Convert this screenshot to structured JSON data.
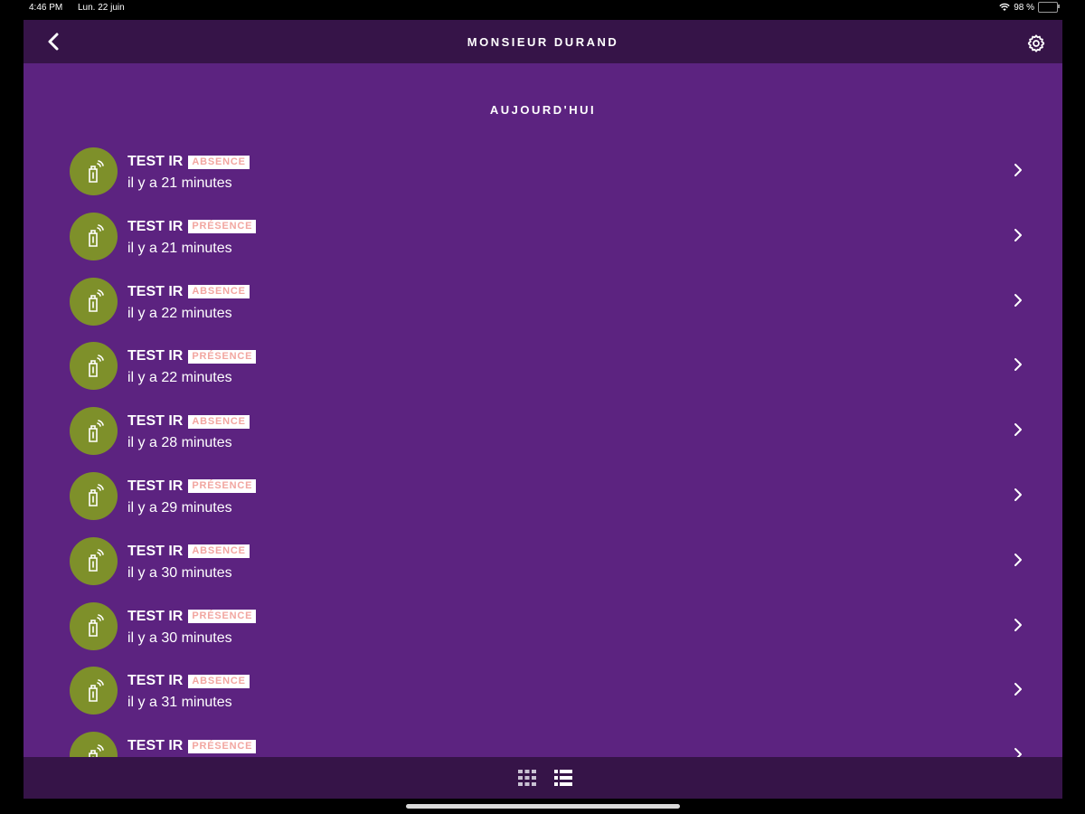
{
  "status_bar": {
    "time": "4:46 PM",
    "date": "Lun. 22 juin",
    "battery": "98 %"
  },
  "header": {
    "title": "MONSIEUR DURAND"
  },
  "section": {
    "title": "AUJOURD'HUI"
  },
  "events": [
    {
      "name": "TEST IR",
      "status": "ABSENCE",
      "time": "il y a 21 minutes"
    },
    {
      "name": "TEST IR",
      "status": "PRÉSENCE",
      "time": "il y a 21 minutes"
    },
    {
      "name": "TEST IR",
      "status": "ABSENCE",
      "time": "il y a 22 minutes"
    },
    {
      "name": "TEST IR",
      "status": "PRÉSENCE",
      "time": "il y a 22 minutes"
    },
    {
      "name": "TEST IR",
      "status": "ABSENCE",
      "time": "il y a 28 minutes"
    },
    {
      "name": "TEST IR",
      "status": "PRÉSENCE",
      "time": "il y a 29 minutes"
    },
    {
      "name": "TEST IR",
      "status": "ABSENCE",
      "time": "il y a 30 minutes"
    },
    {
      "name": "TEST IR",
      "status": "PRÉSENCE",
      "time": "il y a 30 minutes"
    },
    {
      "name": "TEST IR",
      "status": "ABSENCE",
      "time": "il y a 31 minutes"
    },
    {
      "name": "TEST IR",
      "status": "PRÉSENCE",
      "time": ""
    }
  ],
  "colors": {
    "background": "#5c2380",
    "bars": "#361448",
    "avatar": "#7e902a",
    "badge_text": "#f2a6a0"
  },
  "icons": {
    "back": "chevron-left-icon",
    "settings": "gear-icon",
    "item_avatar": "sensor-icon",
    "item_chevron": "chevron-right-icon",
    "grid_view": "grid-icon",
    "list_view": "list-icon"
  }
}
